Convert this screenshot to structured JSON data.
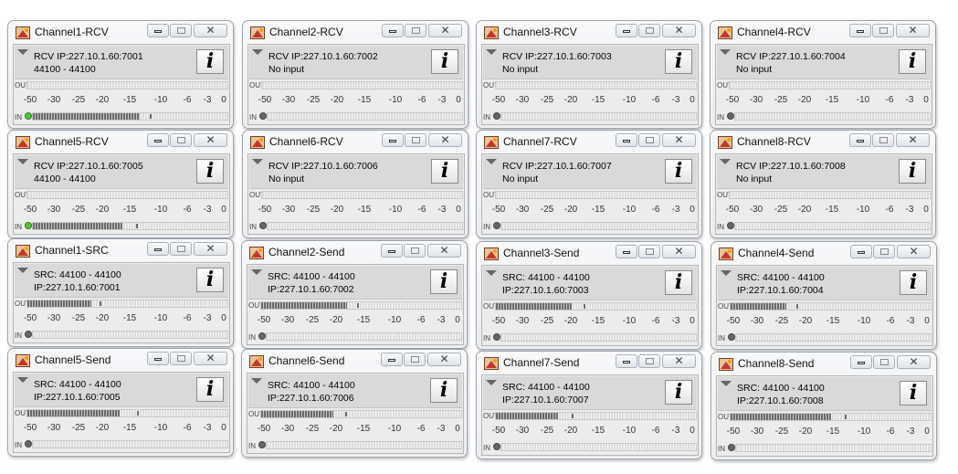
{
  "scale_ticks": [
    "-50",
    "-30",
    "-25",
    "-20",
    "-15",
    "-10",
    "-6",
    "-3",
    "0"
  ],
  "meter_labels": {
    "out": "OUT",
    "in": "IN"
  },
  "info_button_label": "i",
  "windows": [
    {
      "title": "Channel1-RCV",
      "line1": "RCV IP:227.10.1.60:7001",
      "line2": "44100 - 44100",
      "in_led": "on",
      "out_level": 0,
      "out_peak": 0,
      "in_level": 0.55,
      "in_peak": 0.6
    },
    {
      "title": "Channel2-RCV",
      "line1": "RCV IP:227.10.1.60:7002",
      "line2": "No input",
      "in_led": "off",
      "out_level": 0,
      "out_peak": 0,
      "in_level": 0,
      "in_peak": 0
    },
    {
      "title": "Channel3-RCV",
      "line1": "RCV IP:227.10.1.60:7003",
      "line2": "No input",
      "in_led": "off",
      "out_level": 0,
      "out_peak": 0,
      "in_level": 0,
      "in_peak": 0
    },
    {
      "title": "Channel4-RCV",
      "line1": "RCV IP:227.10.1.60:7004",
      "line2": "No input",
      "in_led": "off",
      "out_level": 0,
      "out_peak": 0,
      "in_level": 0,
      "in_peak": 0
    },
    {
      "title": "Channel5-RCV",
      "line1": "RCV IP:227.10.1.60:7005",
      "line2": "44100 - 44100",
      "in_led": "on",
      "out_level": 0,
      "out_peak": 0,
      "in_level": 0.46,
      "in_peak": 0.53
    },
    {
      "title": "Channel6-RCV",
      "line1": "RCV IP:227.10.1.60:7006",
      "line2": "No input",
      "in_led": "off",
      "out_level": 0,
      "out_peak": 0,
      "in_level": 0,
      "in_peak": 0
    },
    {
      "title": "Channel7-RCV",
      "line1": "RCV IP:227.10.1.60:7007",
      "line2": "No input",
      "in_led": "off",
      "out_level": 0,
      "out_peak": 0,
      "in_level": 0,
      "in_peak": 0
    },
    {
      "title": "Channel8-RCV",
      "line1": "RCV IP:227.10.1.60:7008",
      "line2": "No input",
      "in_led": "off",
      "out_level": 0,
      "out_peak": 0,
      "in_level": 0,
      "in_peak": 0
    },
    {
      "title": "Channel1-SRC",
      "line1": "SRC: 44100 - 44100",
      "line2": "IP:227.10.1.60:7001",
      "in_led": "off",
      "out_level": 0.32,
      "out_peak": 0.36,
      "in_level": 0,
      "in_peak": 0
    },
    {
      "title": "Channel2-Send",
      "line1": "SRC: 44100 - 44100",
      "line2": "IP:227.10.1.60:7002",
      "in_led": "off",
      "out_level": 0.43,
      "out_peak": 0.48,
      "in_level": 0,
      "in_peak": 0
    },
    {
      "title": "Channel3-Send",
      "line1": "SRC: 44100 - 44100",
      "line2": "IP:227.10.1.60:7003",
      "in_led": "off",
      "out_level": 0.38,
      "out_peak": 0.44,
      "in_level": 0,
      "in_peak": 0
    },
    {
      "title": "Channel4-Send",
      "line1": "SRC: 44100 - 44100",
      "line2": "IP:227.10.1.60:7004",
      "in_led": "off",
      "out_level": 0.28,
      "out_peak": 0.33,
      "in_level": 0,
      "in_peak": 0
    },
    {
      "title": "Channel5-Send",
      "line1": "SRC: 44100 - 44100",
      "line2": "IP:227.10.1.60:7005",
      "in_led": "off",
      "out_level": 0.46,
      "out_peak": 0.55,
      "in_level": 0,
      "in_peak": 0
    },
    {
      "title": "Channel6-Send",
      "line1": "SRC: 44100 - 44100",
      "line2": "IP:227.10.1.60:7006",
      "in_led": "off",
      "out_level": 0.36,
      "out_peak": 0.42,
      "in_level": 0,
      "in_peak": 0
    },
    {
      "title": "Channel7-Send",
      "line1": "SRC: 44100 - 44100",
      "line2": "IP:227.10.1.60:7007",
      "in_led": "off",
      "out_level": 0.31,
      "out_peak": 0.38,
      "in_level": 0,
      "in_peak": 0
    },
    {
      "title": "Channel8-Send",
      "line1": "SRC: 44100 - 44100",
      "line2": "IP:227.10.1.60:7008",
      "in_led": "off",
      "out_level": 0.5,
      "out_peak": 0.57,
      "in_level": 0,
      "in_peak": 0
    }
  ]
}
